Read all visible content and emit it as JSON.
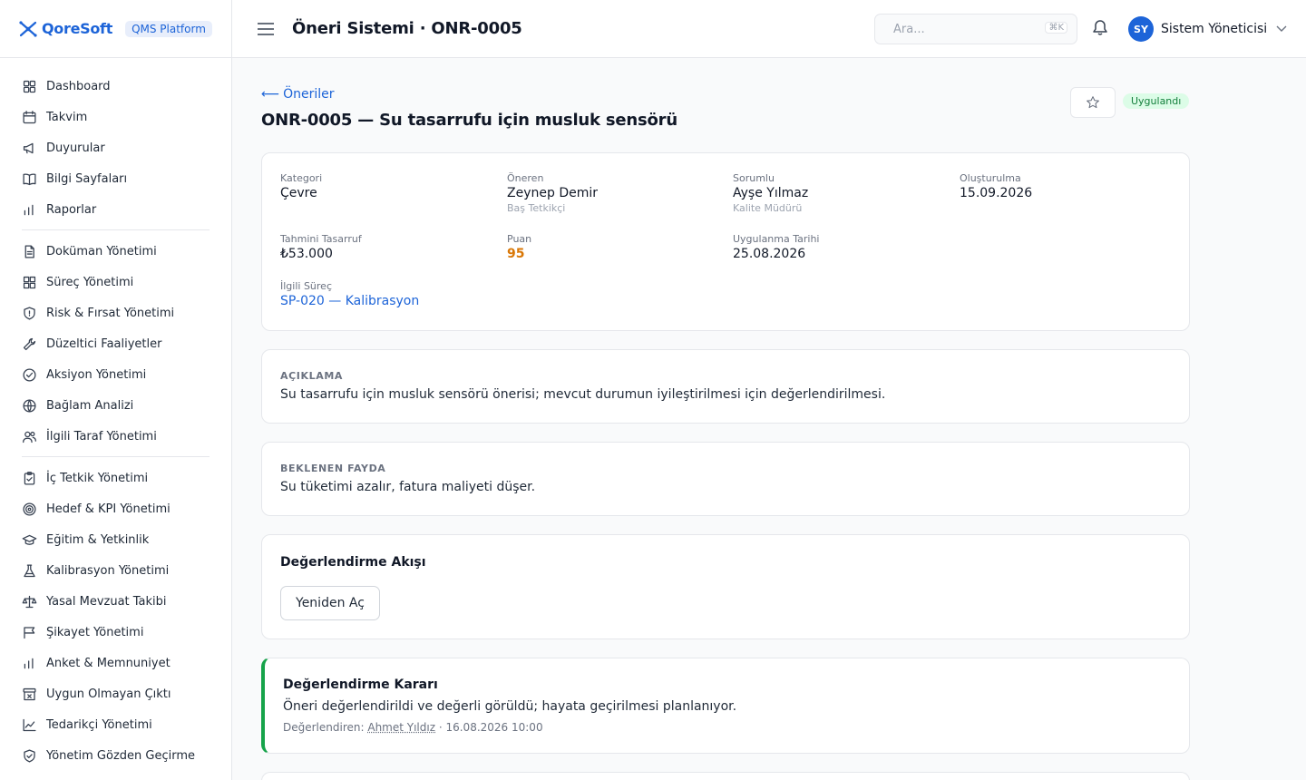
{
  "brand": {
    "name": "QoreSoft",
    "platform": "QMS Platform"
  },
  "sidebar": {
    "groups": [
      [
        {
          "label": "Dashboard",
          "icon": "dashboard-grid-icon"
        },
        {
          "label": "Takvim",
          "icon": "calendar-icon"
        },
        {
          "label": "Duyurular",
          "icon": "megaphone-icon"
        },
        {
          "label": "Bilgi Sayfaları",
          "icon": "book-icon"
        },
        {
          "label": "Raporlar",
          "icon": "bar-chart-icon"
        }
      ],
      [
        {
          "label": "Doküman Yönetimi",
          "icon": "document-icon"
        },
        {
          "label": "Süreç Yönetimi",
          "icon": "process-grid-icon"
        },
        {
          "label": "Risk & Fırsat Yönetimi",
          "icon": "shield-alert-icon"
        },
        {
          "label": "Düzeltici Faaliyetler",
          "icon": "wrench-icon"
        },
        {
          "label": "Aksiyon Yönetimi",
          "icon": "check-circle-icon"
        },
        {
          "label": "Bağlam Analizi",
          "icon": "globe-icon"
        },
        {
          "label": "İlgili Taraf Yönetimi",
          "icon": "users-icon"
        }
      ],
      [
        {
          "label": "İç Tetkik Yönetimi",
          "icon": "clipboard-check-icon"
        },
        {
          "label": "Hedef & KPI Yönetimi",
          "icon": "target-icon"
        },
        {
          "label": "Eğitim & Yetkinlik",
          "icon": "graduation-cap-icon"
        },
        {
          "label": "Kalibrasyon Yönetimi",
          "icon": "flask-icon"
        },
        {
          "label": "Yasal Mevzuat Takibi",
          "icon": "scale-icon"
        },
        {
          "label": "Şikayet Yönetimi",
          "icon": "message-flag-icon"
        },
        {
          "label": "Anket & Memnuniyet",
          "icon": "survey-chart-icon"
        },
        {
          "label": "Uygun Olmayan Çıktı",
          "icon": "archive-x-icon"
        },
        {
          "label": "Tedarikçi Yönetimi",
          "icon": "line-chart-icon"
        },
        {
          "label": "Yönetim Gözden Geçirme",
          "icon": "shield-check-icon"
        }
      ]
    ]
  },
  "header": {
    "title": "Öneri Sistemi · ONR-0005",
    "search_placeholder": "Ara...",
    "search_shortcut": "⌘K",
    "user_initials": "SY",
    "user_name": "Sistem Yöneticisi"
  },
  "detail": {
    "back_label": "Öneriler",
    "title": "ONR-0005 — Su tasarrufu için musluk sensörü",
    "status": "Uygulandı",
    "fields": {
      "kategori_label": "Kategori",
      "kategori": "Çevre",
      "oneren_label": "Öneren",
      "oneren": "Zeynep Demir",
      "oneren_role": "Baş Tetkikçi",
      "sorumlu_label": "Sorumlu",
      "sorumlu": "Ayşe Yılmaz",
      "sorumlu_role": "Kalite Müdürü",
      "olusturulma_label": "Oluşturulma",
      "olusturulma": "15.09.2026",
      "tasarruf_label": "Tahmini Tasarruf",
      "tasarruf": "₺53.000",
      "puan_label": "Puan",
      "puan": "95",
      "uygulanma_label": "Uygulanma Tarihi",
      "uygulanma": "25.08.2026",
      "surec_label": "İlgili Süreç",
      "surec": "SP-020 — Kalibrasyon"
    },
    "aciklama_label": "AÇIKLAMA",
    "aciklama": "Su tasarrufu için musluk sensörü önerisi; mevcut durumun iyileştirilmesi için değerlendirilmesi.",
    "fayda_label": "BEKLENEN FAYDA",
    "fayda": "Su tüketimi azalır, fatura maliyeti düşer.",
    "flow_title": "Değerlendirme Akışı",
    "reopen_label": "Yeniden Aç",
    "decision_title": "Değerlendirme Kararı",
    "decision_text": "Öneri değerlendirildi ve değerli görüldü; hayata geçirilmesi planlanıyor.",
    "decision_by_label": "Değerlendiren:",
    "decision_by": "Ahmet Yıldız",
    "decision_time": "· 16.08.2026 10:00"
  },
  "colors": {
    "accent": "#1d64d8",
    "success": "#16a34a",
    "score": "#d97706"
  }
}
